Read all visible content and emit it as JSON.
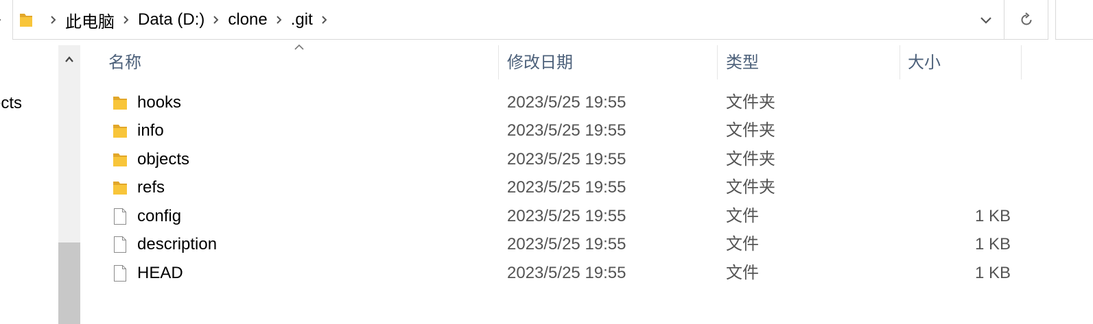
{
  "address_bar": {
    "root_icon": "folder-icon",
    "separator_icon": "chevron-right-icon",
    "breadcrumbs": [
      "此电脑",
      "Data (D:)",
      "clone",
      ".git"
    ],
    "dropdown_icon": "chevron-down-icon",
    "refresh_icon": "refresh-icon"
  },
  "nav_pane": {
    "visible_item_text": "ects",
    "scroll_up_icon": "chevron-up-icon"
  },
  "columns": {
    "sorted_by": "name",
    "sort_icon": "sort-up-icon",
    "headers": [
      "名称",
      "修改日期",
      "类型",
      "大小"
    ]
  },
  "files": [
    {
      "icon": "folder-icon",
      "name": "hooks",
      "date": "2023/5/25 19:55",
      "type": "文件夹",
      "size": ""
    },
    {
      "icon": "folder-icon",
      "name": "info",
      "date": "2023/5/25 19:55",
      "type": "文件夹",
      "size": ""
    },
    {
      "icon": "folder-icon",
      "name": "objects",
      "date": "2023/5/25 19:55",
      "type": "文件夹",
      "size": ""
    },
    {
      "icon": "folder-icon",
      "name": "refs",
      "date": "2023/5/25 19:55",
      "type": "文件夹",
      "size": ""
    },
    {
      "icon": "file-icon",
      "name": "config",
      "date": "2023/5/25 19:55",
      "type": "文件",
      "size": "1 KB"
    },
    {
      "icon": "file-icon",
      "name": "description",
      "date": "2023/5/25 19:55",
      "type": "文件",
      "size": "1 KB"
    },
    {
      "icon": "file-icon",
      "name": "HEAD",
      "date": "2023/5/25 19:55",
      "type": "文件",
      "size": "1 KB"
    }
  ],
  "colors": {
    "folder_yellow": "#f8c53a",
    "header_text": "#4c607a",
    "secondary_text": "#545454",
    "border": "#d9d9d9"
  }
}
